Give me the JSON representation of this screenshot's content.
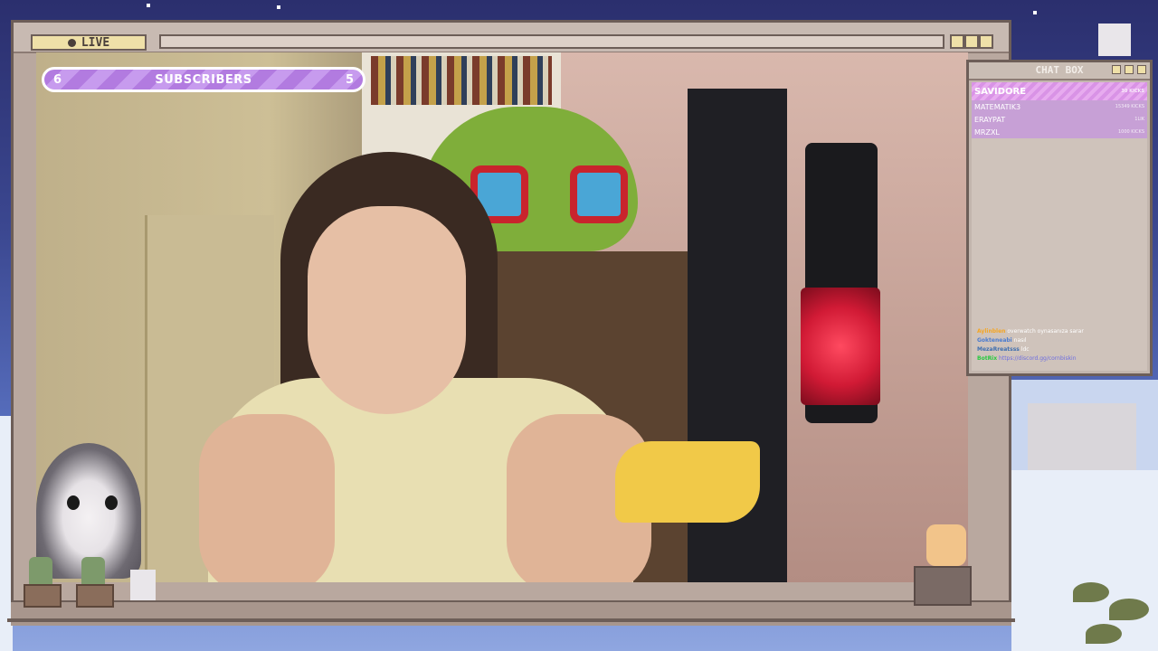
{
  "stream": {
    "live_label": "LIVE"
  },
  "subscribers": {
    "current": "6",
    "label": "SUBSCRIBERS",
    "goal": "5"
  },
  "chatbox": {
    "title": "CHAT BOX",
    "leaderboard": [
      {
        "name": "SAVIDORE",
        "amount": "30 KICKS"
      },
      {
        "name": "MATEMATIK3",
        "amount": "15349 KICKS"
      },
      {
        "name": "ERAYPAT",
        "amount": "1LIK"
      },
      {
        "name": "MRZXL",
        "amount": "1000 KICKS"
      }
    ],
    "messages": [
      {
        "user": "Aylinblen",
        "text": "overwatch oynasanıza sarar"
      },
      {
        "user": "Gokteneabi",
        "text": "nasıl"
      },
      {
        "user": "MezaRreatsss",
        "text": "ldc"
      },
      {
        "user": "BotRix",
        "text": "https://discord.gg/cornbiskin"
      }
    ]
  },
  "colors": {
    "frame": "#b9a89f",
    "accent_purple": "#b27be0",
    "live_badge": "#efe0a8",
    "sky": "#3b4790"
  }
}
